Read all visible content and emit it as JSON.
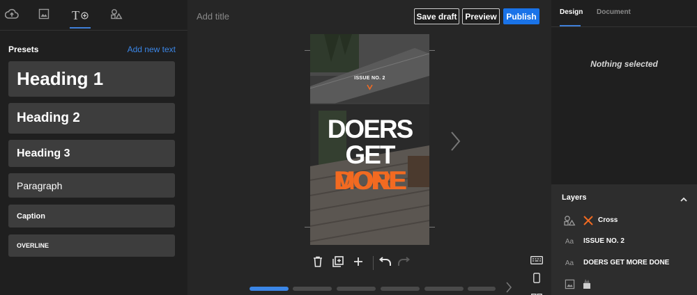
{
  "left_panel": {
    "tabs": [
      {
        "icon": "cloud-upload-icon"
      },
      {
        "icon": "image-icon"
      },
      {
        "icon": "text-add-icon",
        "label": "T"
      },
      {
        "icon": "shapes-icon"
      }
    ],
    "presets_title": "Presets",
    "add_new_text": "Add new text",
    "presets": [
      "Heading 1",
      "Heading 2",
      "Heading 3",
      "Paragraph",
      "Caption",
      "OVERLINE"
    ]
  },
  "editor": {
    "title_placeholder": "Add title",
    "save_draft": "Save draft",
    "preview": "Preview",
    "publish": "Publish",
    "page": {
      "issue_label": "ISSUE NO. 2",
      "headline_lines": [
        {
          "text": "DOERS",
          "color": "#ffffff"
        },
        {
          "text": "GET",
          "accent_text": "MORE",
          "color": "#ffffff",
          "accent": "#f26a21"
        },
        {
          "text": "DONE",
          "color": "#f26a21"
        }
      ]
    },
    "tools": [
      "delete-icon",
      "duplicate-icon",
      "add-icon",
      "undo-icon",
      "redo-icon"
    ],
    "progress_segments": 6,
    "active_segment": 0
  },
  "right_panel": {
    "tabs": [
      "Design",
      "Document"
    ],
    "active_tab": "Design",
    "empty_state": "Nothing selected",
    "layers_title": "Layers",
    "layers": [
      {
        "icon": "shape-icon",
        "name": "Cross"
      },
      {
        "icon": "text-icon",
        "icon_text": "Aa",
        "name": "ISSUE NO. 2"
      },
      {
        "icon": "text-icon",
        "icon_text": "Aa",
        "name": "DOERS  GET MORE DONE"
      },
      {
        "icon": "background-image-icon",
        "name": ""
      }
    ]
  },
  "colors": {
    "accent_blue": "#1a73e8",
    "brand_orange": "#f26a21"
  }
}
